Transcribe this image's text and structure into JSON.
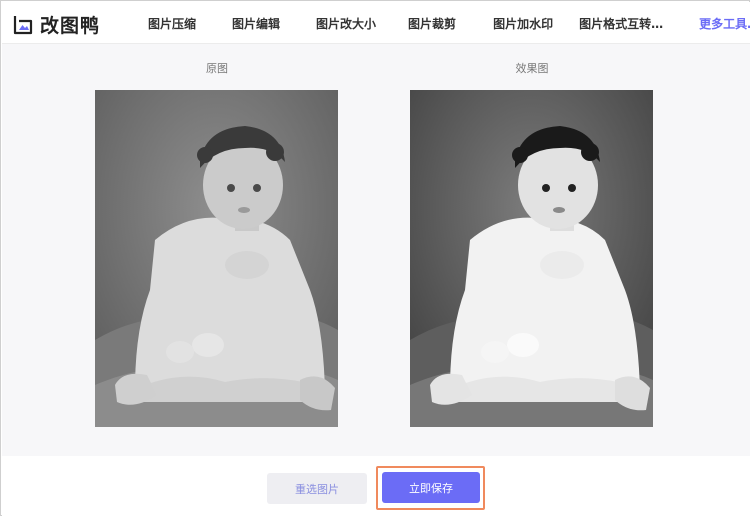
{
  "app": {
    "brand": "改图鸭",
    "accent_color": "#6b6cf6",
    "highlight_color": "#f08a5d"
  },
  "nav": {
    "items": [
      {
        "label": "图片压缩"
      },
      {
        "label": "图片编辑"
      },
      {
        "label": "图片改大小"
      },
      {
        "label": "图片裁剪"
      },
      {
        "label": "图片加水印"
      },
      {
        "label": "图片格式互转…"
      }
    ],
    "more": "更多工具…"
  },
  "compare": {
    "original_label": "原图",
    "result_label": "效果图"
  },
  "actions": {
    "reselect": "重选图片",
    "save": "立即保存"
  }
}
